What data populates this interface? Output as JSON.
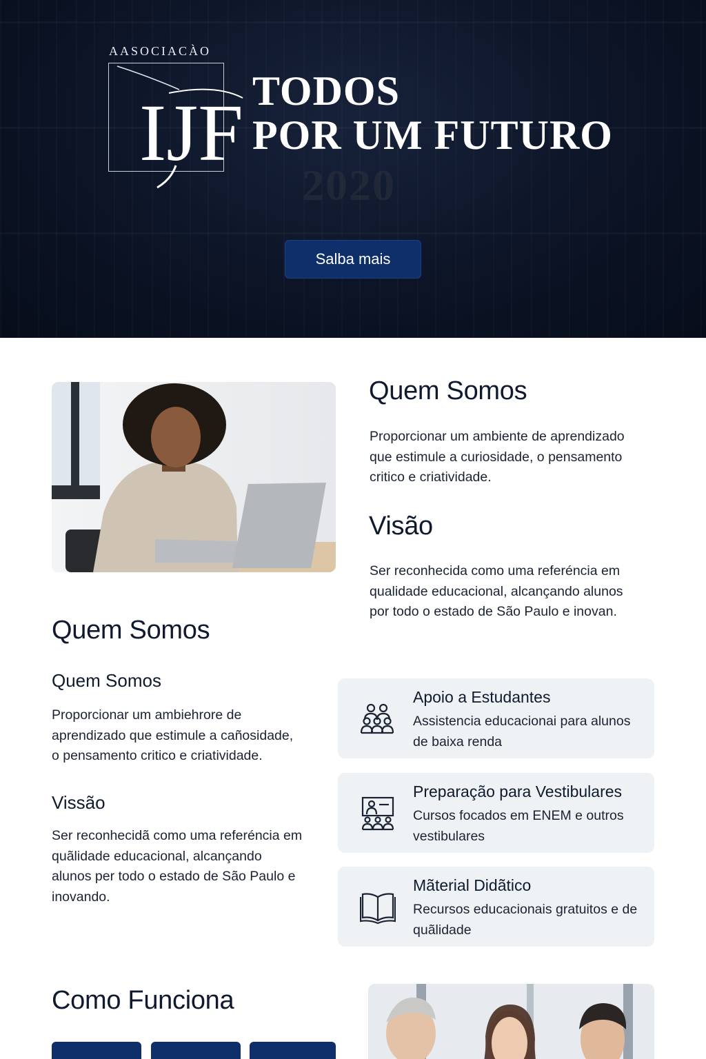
{
  "hero": {
    "logo_top_text": "AASOCIACÀO",
    "logo_mark": "IJF",
    "title_line1": "TODOS",
    "title_line2": "POR UM FUTURO",
    "watermark": "2020",
    "cta_label": "Salba mais"
  },
  "about_top": {
    "heading_who": "Quem Somos",
    "text_who": "Proporcionar um ambiente de aprendizado que estimule a curiosidade, o pensamento critico e criatividade.",
    "heading_vision": "Visão",
    "text_vision": "Ser reconhecida como uma referéncia em qualidade educacional, alcançando alunos por todo o estado de São Paulo e inovan."
  },
  "about_bottom": {
    "section_title": "Quem Somos",
    "sub_who": "Quem Somos",
    "text_who": "Proporcionar um ambiehrore de aprendizado que estimule a cañosidade, o pensamento critico e criatividade.",
    "sub_vision": "Vissão",
    "text_vision": "Ser reconhecidã como uma referéncia em quãlidade educacional, alcançando alunos per todo o estado de São Paulo e inovando."
  },
  "services": [
    {
      "icon": "people-group-icon",
      "title": "Apoio a Estudantes",
      "desc": "Assistencia educacionai para alunos de baixa renda"
    },
    {
      "icon": "classroom-icon",
      "title": "Preparação para Vestibulares",
      "desc": "Cursos focados em ENEM e outros vestibulares"
    },
    {
      "icon": "open-book-icon",
      "title": "Mãterial Didãtico",
      "desc": "Recursos educacionais gratuitos e de quãlidade"
    }
  ],
  "how_it_works": {
    "title": "Como Funciona"
  },
  "colors": {
    "hero_bg": "#0c1426",
    "primary_button": "#0f2f6b",
    "card_bg": "#eef2f4",
    "text_dark": "#0f1a2e"
  }
}
